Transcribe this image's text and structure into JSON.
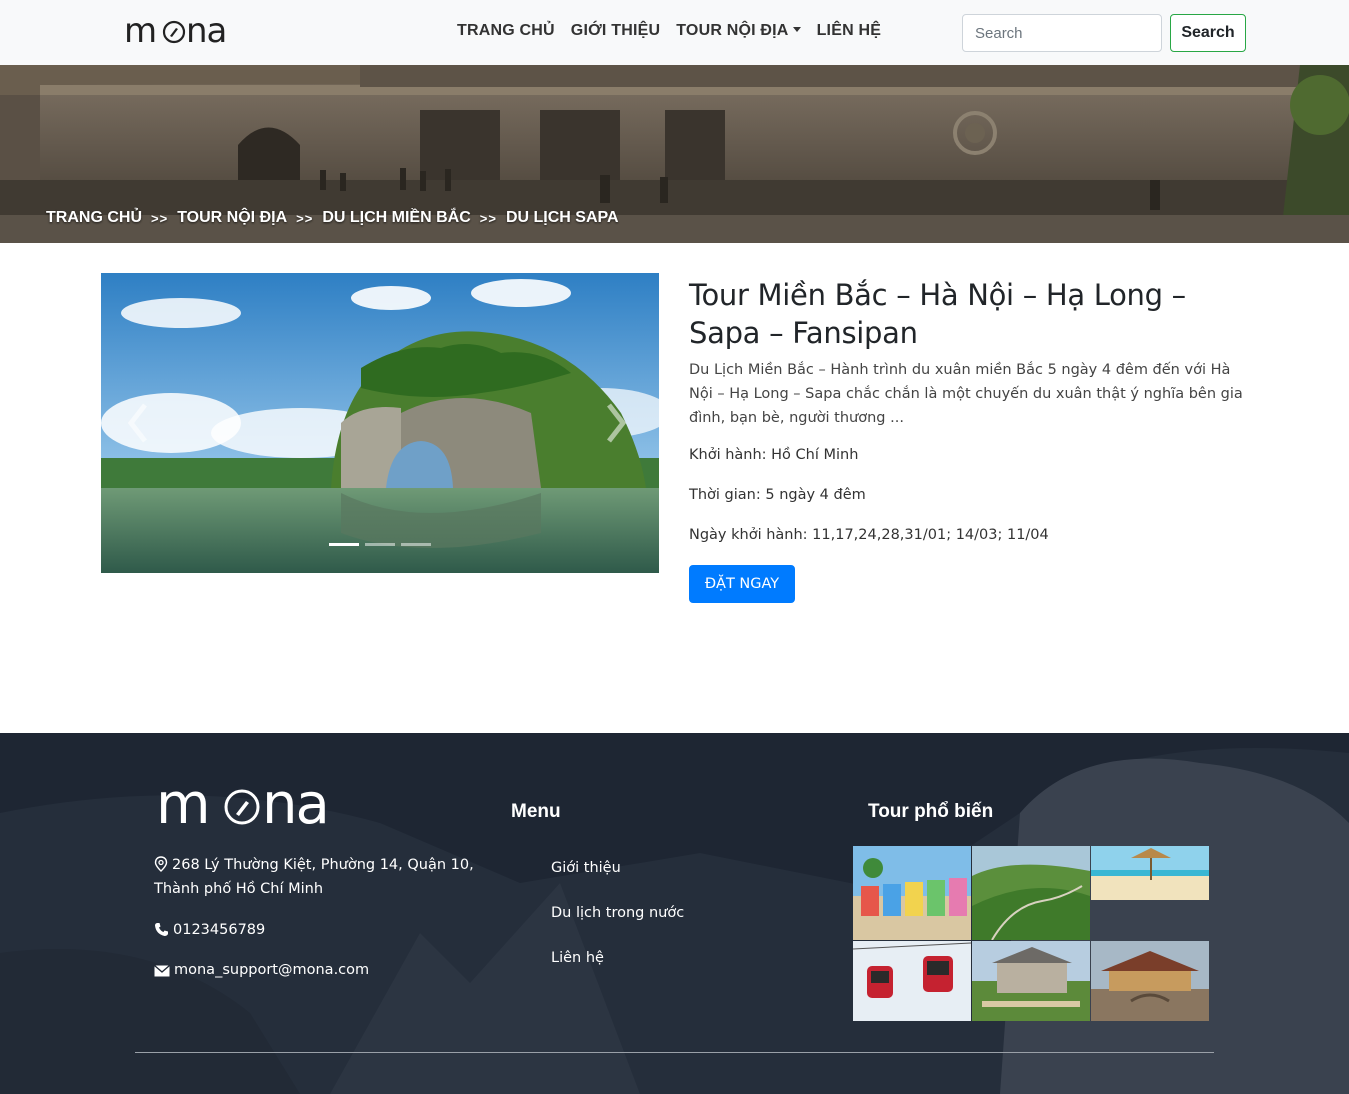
{
  "header": {
    "logo_text": "mona",
    "nav": [
      {
        "label": "TRANG CHỦ"
      },
      {
        "label": "GIỚI THIỆU"
      },
      {
        "label": "TOUR NỘI ĐỊA"
      },
      {
        "label": "LIÊN HỆ"
      }
    ],
    "search_placeholder": "Search",
    "search_button": "Search"
  },
  "breadcrumb": {
    "items": [
      "TRANG CHỦ",
      "TOUR NỘI ĐỊA",
      "DU LỊCH MIỀN BẮC",
      "DU LỊCH SAPA"
    ],
    "separator": ">>"
  },
  "tour": {
    "title": "Tour Miền Bắc – Hà Nội – Hạ Long – Sapa – Fansipan",
    "description": "Du Lịch Miền Bắc – Hành trình du xuân miền Bắc 5 ngày 4 đêm đến với Hà Nội – Hạ Long – Sapa chắc chắn là một chuyến du xuân thật ý nghĩa bên gia đình, bạn bè, người thương ...",
    "departure": "Khởi hành: Hồ Chí Minh",
    "duration": "Thời gian: 5 ngày 4 đêm",
    "dates": "Ngày khởi hành: 11,17,24,28,31/01; 14/03; 11/04",
    "book_button": "ĐẶT NGAY",
    "carousel_slides": 3,
    "carousel_active": 1
  },
  "footer": {
    "logo_text": "mona",
    "address": "268 Lý Thường Kiệt, Phường 14, Quận 10, Thành phố Hồ Chí Minh",
    "phone": "0123456789",
    "email": "mona_support@mona.com",
    "menu_heading": "Menu",
    "menu_items": [
      "Giới thiệu",
      "Du lịch trong nước",
      "Liên hệ"
    ],
    "popular_heading": "Tour phổ biến"
  },
  "colors": {
    "primary": "#007bff",
    "success": "#28a745",
    "navbar_bg": "#f8f9fa",
    "footer_bg": "#1c2330"
  }
}
